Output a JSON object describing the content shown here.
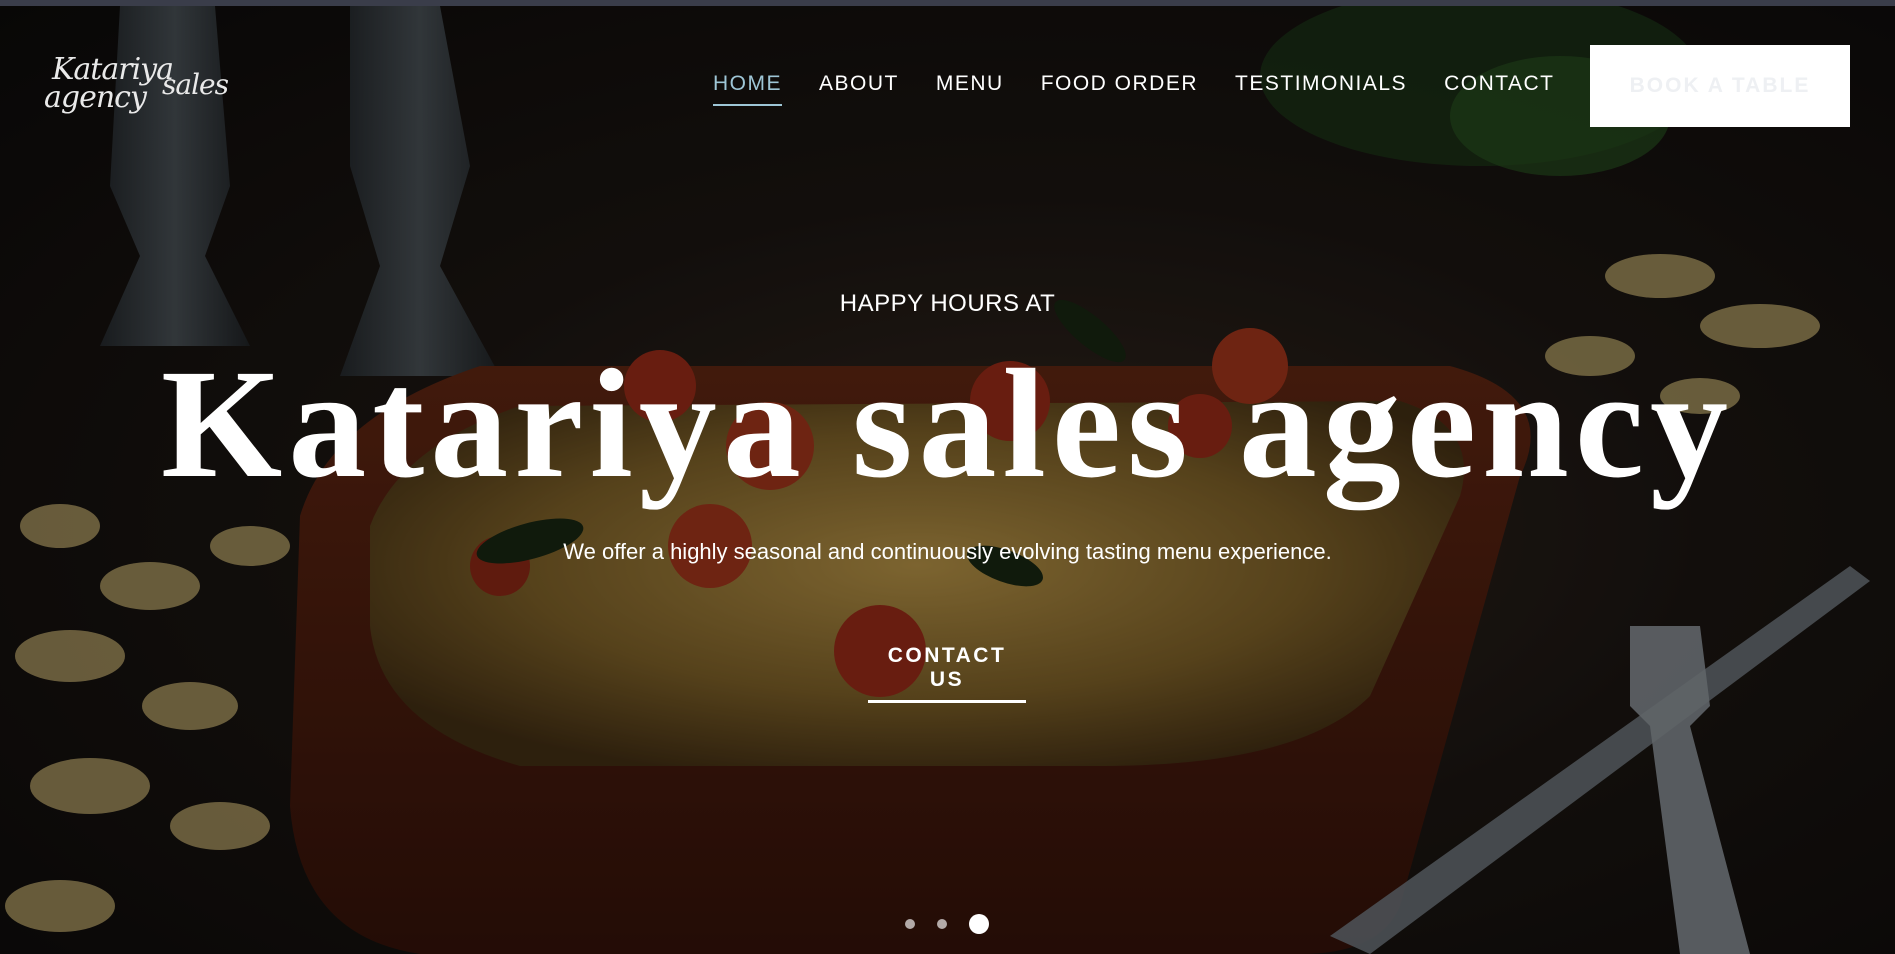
{
  "logo": {
    "line1": "Katariya",
    "line2": "agency",
    "line3": "sales"
  },
  "nav": {
    "items": [
      {
        "label": "HOME"
      },
      {
        "label": "ABOUT"
      },
      {
        "label": "MENU"
      },
      {
        "label": "FOOD ORDER"
      },
      {
        "label": "TESTIMONIALS"
      },
      {
        "label": "CONTACT"
      }
    ],
    "active_index": 0,
    "book_label": "BOOK A TABLE"
  },
  "hero": {
    "kicker": "HAPPY HOURS AT",
    "title": "Katariya sales agency",
    "tagline": "We offer a highly seasonal and continuously evolving tasting menu experience.",
    "cta_label": "CONTACT US"
  },
  "slider": {
    "count": 3,
    "active_index": 2
  },
  "colors": {
    "nav_active": "#9ec6d6",
    "text": "#ffffff",
    "button_bg": "#ffffff"
  },
  "icons": {
    "background": "food-photo-pasta-bake"
  }
}
